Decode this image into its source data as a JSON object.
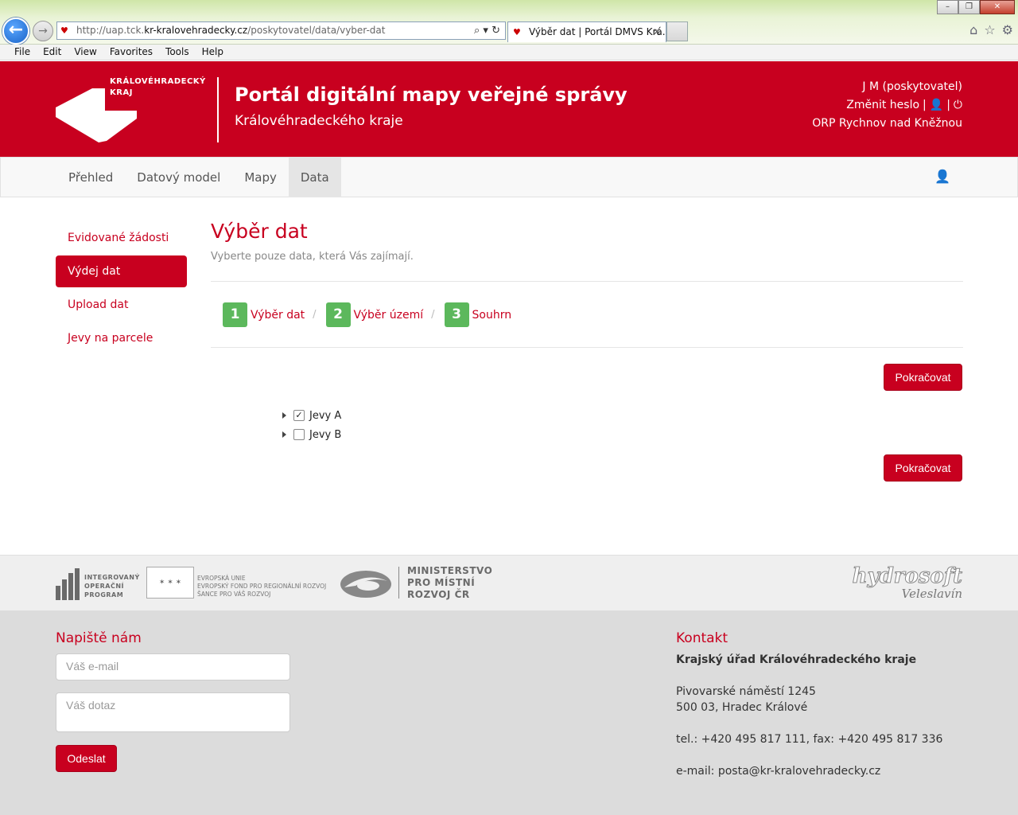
{
  "browser": {
    "url_prefix": "http://uap.tck.",
    "url_host": "kr-kralovehradecky.cz",
    "url_path": "/poskytovatel/data/vyber-dat",
    "tab_title": "Výběr dat | Portál DMVS Krá...",
    "menu": [
      "File",
      "Edit",
      "View",
      "Favorites",
      "Tools",
      "Help"
    ]
  },
  "header": {
    "logo_line1": "KRÁLOVÉHRADECKÝ",
    "logo_line2": "KRAJ",
    "title": "Portál digitální mapy veřejné správy",
    "subtitle": "Královéhradeckého kraje",
    "user_name": "J M (poskytovatel)",
    "change_password": "Změnit heslo",
    "organization": "ORP Rychnov nad Kněžnou"
  },
  "nav": {
    "items": [
      "Přehled",
      "Datový model",
      "Mapy",
      "Data"
    ],
    "active_index": 3
  },
  "sidebar": {
    "items": [
      "Evidované žádosti",
      "Výdej dat",
      "Upload dat",
      "Jevy na parcele"
    ]
  },
  "main": {
    "title": "Výběr dat",
    "description": "Vyberte pouze data, která Vás zajímají.",
    "steps": [
      {
        "num": "1",
        "label": "Výběr dat"
      },
      {
        "num": "2",
        "label": "Výběr území"
      },
      {
        "num": "3",
        "label": "Souhrn"
      }
    ],
    "continue_label": "Pokračovat",
    "tree": [
      {
        "label": "Jevy A",
        "checked": true
      },
      {
        "label": "Jevy B",
        "checked": false
      }
    ]
  },
  "logos": {
    "iop": [
      "INTEGROVANÝ",
      "OPERAČNÍ",
      "PROGRAM"
    ],
    "eu": [
      "EVROPSKÁ UNIE",
      "EVROPSKÝ FOND PRO REGIONÁLNÍ ROZVOJ",
      "ŠANCE PRO VÁŠ ROZVOJ"
    ],
    "mmr": [
      "MINISTERSTVO",
      "PRO MÍSTNÍ",
      "ROZVOJ ČR"
    ],
    "hydro_name": "hydrosoft",
    "hydro_sub": "Veleslavín"
  },
  "footer": {
    "write_heading": "Napiště nám",
    "email_placeholder": "Váš e-mail",
    "question_placeholder": "Váš dotaz",
    "send_label": "Odeslat",
    "contact_heading": "Kontakt",
    "org": "Krajský úřad Královéhradeckého kraje",
    "address1": "Pivovarské náměstí 1245",
    "address2": "500 03, Hradec Králové",
    "phone": "tel.: +420 495 817 111, fax: +420 495 817 336",
    "email": "e-mail: posta@kr-kralovehradecky.cz"
  }
}
